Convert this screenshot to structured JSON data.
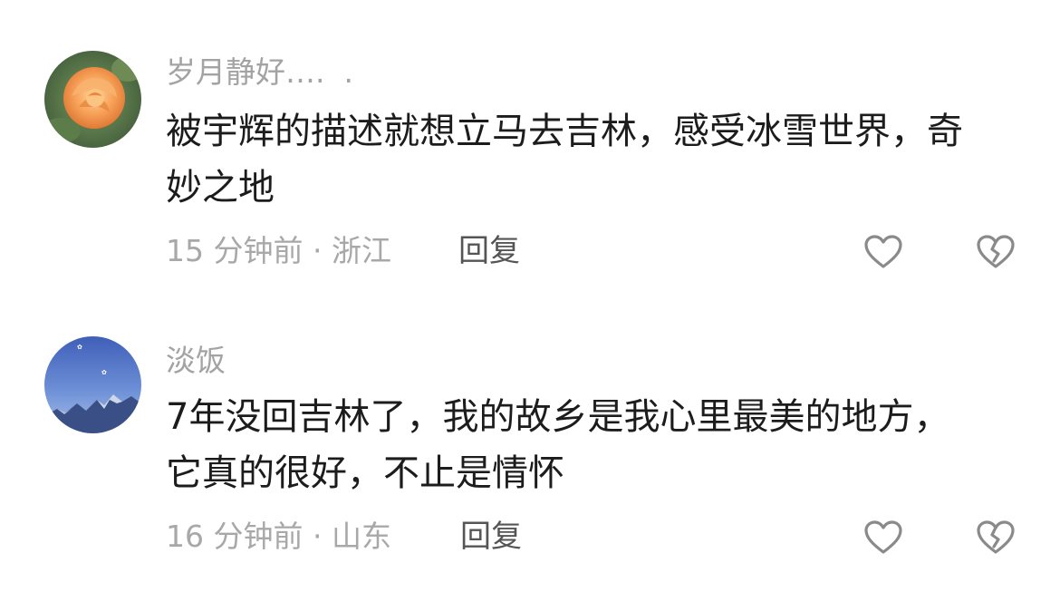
{
  "comments": [
    {
      "username": "岁月静好….  .",
      "text": "被宇辉的描述就想立马去吉林，感受冰雪世界，奇妙之地",
      "time": "15 分钟前",
      "separator": "·",
      "location": "浙江",
      "reply_label": "回复",
      "avatar_icon": "orange-rose-avatar",
      "like_icon": "heart-outline-icon",
      "dislike_icon": "broken-heart-icon"
    },
    {
      "username": "淡饭",
      "text": "7年没回吉林了，我的故乡是我心里最美的地方，它真的很好，不止是情怀",
      "time": "16 分钟前",
      "separator": "·",
      "location": "山东",
      "reply_label": "回复",
      "avatar_icon": "sky-mountain-avatar",
      "like_icon": "heart-outline-icon",
      "dislike_icon": "broken-heart-icon"
    }
  ],
  "colors": {
    "username": "#a3a3a3",
    "text": "#1c1c1c",
    "meta": "#a8a8a8",
    "reply": "#555555",
    "icon": "#8a8a8a"
  }
}
